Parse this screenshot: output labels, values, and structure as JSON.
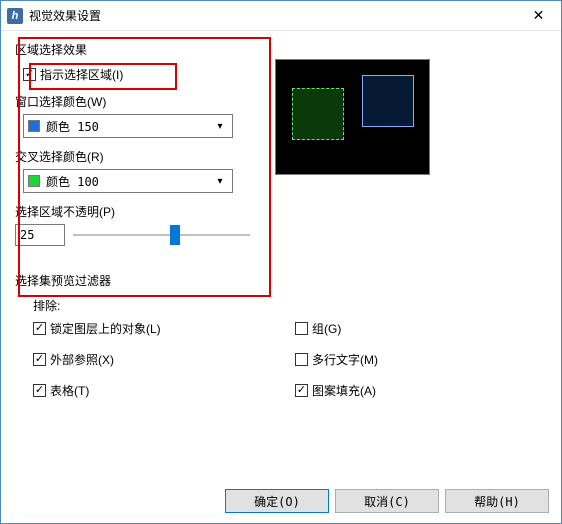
{
  "title": "视觉效果设置",
  "section_area": {
    "label": "区域选择效果",
    "indicate_checkbox": {
      "label": "指示选择区域(I)",
      "checked": true
    },
    "window_color": {
      "label": "窗口选择颜色(W)",
      "value": "颜色 150",
      "swatch": "#1f6fd6"
    },
    "cross_color": {
      "label": "交叉选择颜色(R)",
      "value": "颜色 100",
      "swatch": "#1fd63a"
    },
    "opacity": {
      "label": "选择区域不透明(P)",
      "value": "25",
      "percent": 55
    }
  },
  "filter": {
    "label": "选择集预览过滤器",
    "exclude_label": "排除:",
    "items": [
      {
        "label": "锁定图层上的对象(L)",
        "checked": true
      },
      {
        "label": "组(G)",
        "checked": false
      },
      {
        "label": "外部参照(X)",
        "checked": true
      },
      {
        "label": "多行文字(M)",
        "checked": false
      },
      {
        "label": "表格(T)",
        "checked": true
      },
      {
        "label": "图案填充(A)",
        "checked": true
      }
    ]
  },
  "buttons": {
    "ok": "确定(O)",
    "cancel": "取消(C)",
    "help": "帮助(H)"
  }
}
